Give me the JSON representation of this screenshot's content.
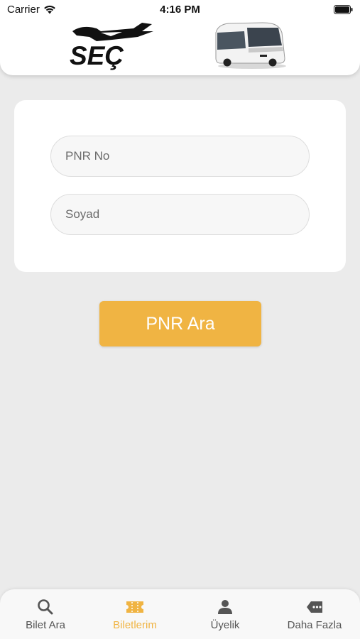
{
  "status_bar": {
    "carrier": "Carrier",
    "time": "4:16 PM"
  },
  "header": {
    "logo_text": "SEÇ"
  },
  "form": {
    "pnr_placeholder": "PNR No",
    "surname_placeholder": "Soyad",
    "search_label": "PNR Ara"
  },
  "tabs": [
    {
      "label": "Bilet Ara",
      "icon": "search-icon",
      "active": false
    },
    {
      "label": "Biletlerim",
      "icon": "ticket-icon",
      "active": true
    },
    {
      "label": "Üyelik",
      "icon": "person-icon",
      "active": false
    },
    {
      "label": "Daha Fazla",
      "icon": "more-tag-icon",
      "active": false
    }
  ],
  "colors": {
    "accent": "#f0b443",
    "background": "#ebebeb",
    "card": "#ffffff",
    "inactive": "#555555"
  }
}
